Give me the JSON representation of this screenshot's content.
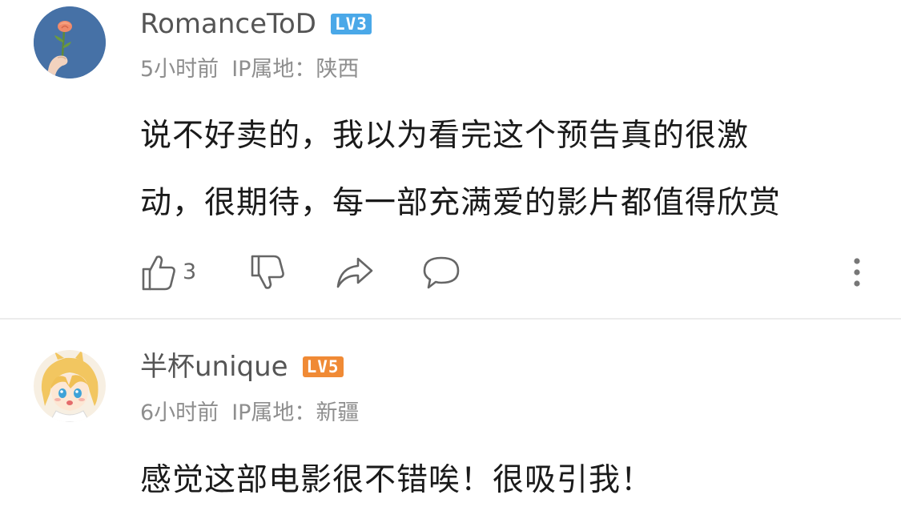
{
  "comments": [
    {
      "username": "RomanceToD",
      "level": "LV3",
      "level_color": "#4aa8e8",
      "time": "5小时前",
      "ip_label": "IP属地：",
      "ip_location": "陕西",
      "text_lines": [
        "说不好卖的，我以为看完这个预告真的很激",
        "动，很期待，每一部充满爱的影片都值得欣赏"
      ],
      "like_count": "3",
      "avatar_icon": "rose-in-hand-avatar",
      "actions": [
        "thumbs-up-icon",
        "thumbs-down-icon",
        "share-icon",
        "reply-icon",
        "more-vertical-icon"
      ]
    },
    {
      "username": "半杯unique",
      "level": "LV5",
      "level_color": "#f08a35",
      "time": "6小时前",
      "ip_label": "IP属地：",
      "ip_location": "新疆",
      "text_lines": [
        "感觉这部电影很不错唉！很吸引我！"
      ],
      "avatar_icon": "anime-character-avatar"
    }
  ],
  "colors": {
    "username": "#555555",
    "meta": "#8e8e8e",
    "text": "#1a1a1a",
    "icon": "#666666",
    "divider": "#ececec"
  }
}
